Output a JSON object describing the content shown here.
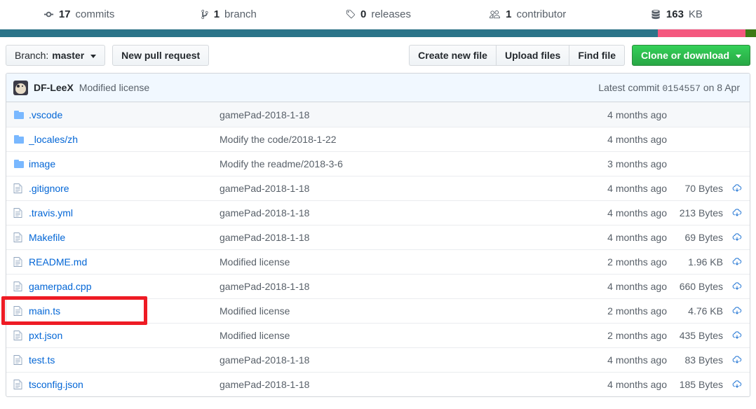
{
  "stats": {
    "items": [
      {
        "icon": "commit-icon",
        "count": "17",
        "label": "commits"
      },
      {
        "icon": "branch-icon",
        "count": "1",
        "label": "branch"
      },
      {
        "icon": "tag-icon",
        "count": "0",
        "label": "releases"
      },
      {
        "icon": "people-icon",
        "count": "1",
        "label": "contributor"
      },
      {
        "icon": "database-icon",
        "count": "163",
        "label": "KB"
      }
    ]
  },
  "languages": [
    {
      "name": "segment-1",
      "color": "#2b7489",
      "percent": 87.0
    },
    {
      "name": "segment-2",
      "color": "#f4577e",
      "percent": 11.6
    },
    {
      "name": "segment-3",
      "color": "#3d7a15",
      "percent": 1.4
    }
  ],
  "toolbar": {
    "branch_prefix": "Branch: ",
    "branch_name": "master",
    "new_pull_request": "New pull request",
    "create_new_file": "Create new file",
    "upload_files": "Upload files",
    "find_file": "Find file",
    "clone_or_download": "Clone or download"
  },
  "commit_bar": {
    "author": "DF-LeeX",
    "message": "Modified license",
    "latest_prefix": "Latest commit",
    "sha": "0154557",
    "date_prefix": "on",
    "date": "8 Apr"
  },
  "files": [
    {
      "type": "folder",
      "name": ".vscode",
      "message": "gamePad-2018-1-18",
      "age": "4 months ago",
      "size": "",
      "download": false,
      "alt": true,
      "highlighted": false
    },
    {
      "type": "folder",
      "name": "_locales/zh",
      "message": "Modify the code/2018-1-22",
      "age": "4 months ago",
      "size": "",
      "download": false,
      "alt": false,
      "highlighted": false
    },
    {
      "type": "folder",
      "name": "image",
      "message": "Modify the readme/2018-3-6",
      "age": "3 months ago",
      "size": "",
      "download": false,
      "alt": false,
      "highlighted": false
    },
    {
      "type": "file",
      "name": ".gitignore",
      "message": "gamePad-2018-1-18",
      "age": "4 months ago",
      "size": "70 Bytes",
      "download": true,
      "alt": false,
      "highlighted": false
    },
    {
      "type": "file",
      "name": ".travis.yml",
      "message": "gamePad-2018-1-18",
      "age": "4 months ago",
      "size": "213 Bytes",
      "download": true,
      "alt": false,
      "highlighted": false
    },
    {
      "type": "file",
      "name": "Makefile",
      "message": "gamePad-2018-1-18",
      "age": "4 months ago",
      "size": "69 Bytes",
      "download": true,
      "alt": false,
      "highlighted": false
    },
    {
      "type": "file",
      "name": "README.md",
      "message": "Modified license",
      "age": "2 months ago",
      "size": "1.96 KB",
      "download": true,
      "alt": false,
      "highlighted": false
    },
    {
      "type": "file",
      "name": "gamerpad.cpp",
      "message": "gamePad-2018-1-18",
      "age": "4 months ago",
      "size": "660 Bytes",
      "download": true,
      "alt": false,
      "highlighted": false
    },
    {
      "type": "file",
      "name": "main.ts",
      "message": "Modified license",
      "age": "2 months ago",
      "size": "4.76 KB",
      "download": true,
      "alt": false,
      "highlighted": true
    },
    {
      "type": "file",
      "name": "pxt.json",
      "message": "Modified license",
      "age": "2 months ago",
      "size": "435 Bytes",
      "download": true,
      "alt": false,
      "highlighted": false
    },
    {
      "type": "file",
      "name": "test.ts",
      "message": "gamePad-2018-1-18",
      "age": "4 months ago",
      "size": "83 Bytes",
      "download": true,
      "alt": false,
      "highlighted": false
    },
    {
      "type": "file",
      "name": "tsconfig.json",
      "message": "gamePad-2018-1-18",
      "age": "4 months ago",
      "size": "185 Bytes",
      "download": true,
      "alt": false,
      "highlighted": false
    }
  ],
  "annotation": {
    "color": "#ee1b24",
    "target": "main.ts"
  }
}
